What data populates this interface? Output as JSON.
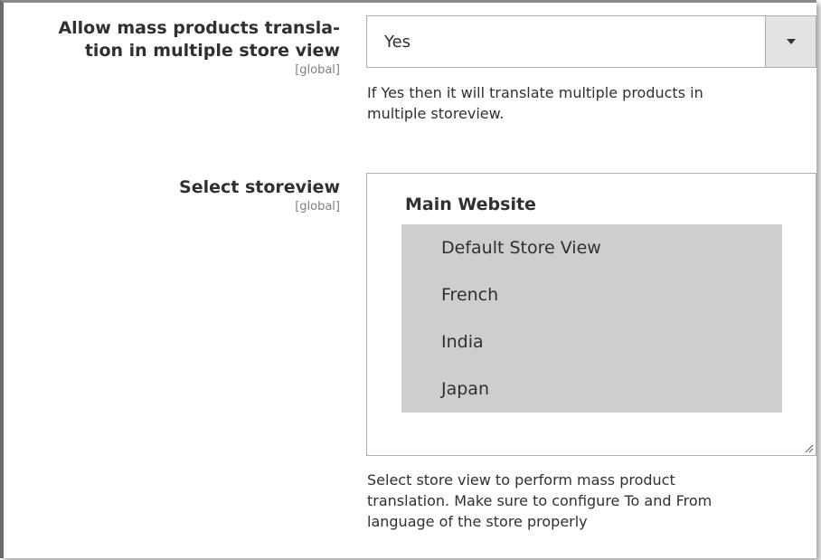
{
  "mass_translation": {
    "label": "Allow mass products transla-tion in multiple store view",
    "label_line1": "Allow mass products transla-",
    "label_line2": "tion in multiple store view",
    "scope": "[global]",
    "value": "Yes",
    "note_line1": "If Yes then it will translate multiple products in",
    "note_line2": "multiple storeview."
  },
  "storeview": {
    "label": "Select storeview",
    "scope": "[global]",
    "group": "Main Website",
    "options": [
      "Default Store View",
      "French",
      "India",
      "Japan"
    ],
    "selected": [
      "Default Store View",
      "French",
      "India",
      "Japan"
    ],
    "note_line1": "Select store view to perform mass product",
    "note_line2": "translation. Make sure to configure To and From",
    "note_line3": "language of the store properly"
  },
  "colors": {
    "selected_option_bg": "#cecece",
    "dropdown_button_bg": "#e3e3e3",
    "border": "#adadad",
    "text": "#303030"
  },
  "icons": {
    "dropdown": "chevron-down-icon",
    "resize": "resize-grip-icon"
  }
}
